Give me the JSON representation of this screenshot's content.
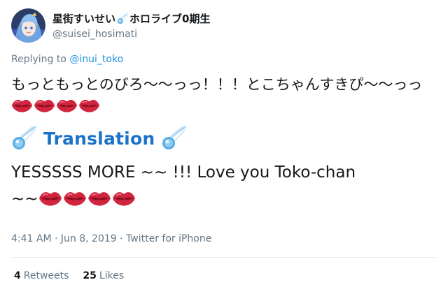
{
  "user": {
    "display_name_part1": "星街すいせい",
    "display_name_part2": "ホロライブ0期生",
    "handle": "@suisei_hosimati",
    "avatar_icon": "user-avatar-icon"
  },
  "reply": {
    "prefix": "Replying to ",
    "mention": "@inui_toko"
  },
  "tweet": {
    "text_jp": "もっともっとのびろ〜〜っっ！！！とこちゃんすきぴ〜〜っっ",
    "translation_label": "Translation",
    "text_en_line1": "YESSSSS MORE ~~ !!! Love you Toko-chan",
    "text_en_line2": "~~"
  },
  "meta": {
    "time": "4:41 AM",
    "sep1": " · ",
    "date": "Jun 8, 2019",
    "sep2": " · ",
    "source": "Twitter for iPhone"
  },
  "stats": {
    "retweets_count": "4",
    "retweets_label": "Retweets",
    "likes_count": "25",
    "likes_label": "Likes"
  },
  "colors": {
    "accent": "#1b95e0",
    "translation": "#1b73c9",
    "muted": "#657786",
    "text": "#14171a",
    "kiss": "#d0243f"
  }
}
